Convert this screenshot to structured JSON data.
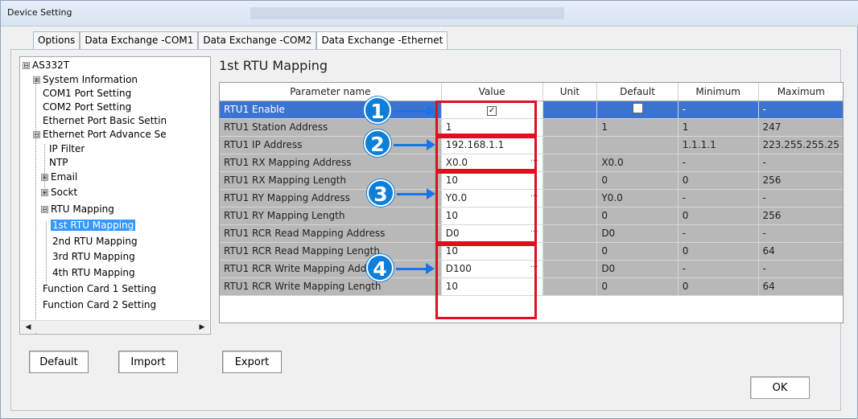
{
  "window": {
    "title": "Device Setting"
  },
  "tabs": [
    {
      "label": "Options"
    },
    {
      "label": "Data Exchange -COM1"
    },
    {
      "label": "Data Exchange -COM2"
    },
    {
      "label": "Data Exchange -Ethernet"
    }
  ],
  "tree": {
    "items": [
      {
        "label": "AS332T"
      },
      {
        "label": "System Information"
      },
      {
        "label": "COM1 Port Setting"
      },
      {
        "label": "COM2 Port Setting"
      },
      {
        "label": "Ethernet Port Basic Settin"
      },
      {
        "label": "Ethernet Port Advance Se"
      },
      {
        "label": "IP Filter"
      },
      {
        "label": "NTP"
      },
      {
        "label": "Email"
      },
      {
        "label": "Sockt"
      },
      {
        "label": "RTU Mapping"
      },
      {
        "label": "1st RTU Mapping"
      },
      {
        "label": "2nd RTU Mapping"
      },
      {
        "label": "3rd RTU Mapping"
      },
      {
        "label": "4th RTU Mapping"
      },
      {
        "label": "Function Card 1 Setting"
      },
      {
        "label": "Function Card 2 Setting"
      }
    ],
    "expanders": {
      "minus": "⊟",
      "plus": "⊞"
    }
  },
  "main": {
    "title": "1st RTU Mapping",
    "columns": [
      "Parameter name",
      "Value",
      "Unit",
      "Default",
      "Minimum",
      "Maximum"
    ],
    "rows": [
      {
        "name": "RTU1 Enable",
        "value": "",
        "unit": "",
        "default": "",
        "min": "-",
        "max": "-"
      },
      {
        "name": "RTU1 Station Address",
        "value": "1",
        "unit": "",
        "default": "1",
        "min": "1",
        "max": "247"
      },
      {
        "name": "RTU1 IP Address",
        "value": "192.168.1.1",
        "unit": "",
        "default": "",
        "min": "1.1.1.1",
        "max": "223.255.255.25"
      },
      {
        "name": "RTU1 RX Mapping Address",
        "value": "X0.0",
        "unit": "",
        "default": "X0.0",
        "min": "-",
        "max": "-"
      },
      {
        "name": "RTU1 RX Mapping Length",
        "value": "10",
        "unit": "",
        "default": "0",
        "min": "0",
        "max": "256"
      },
      {
        "name": "RTU1 RY Mapping Address",
        "value": "Y0.0",
        "unit": "",
        "default": "Y0.0",
        "min": "-",
        "max": "-"
      },
      {
        "name": "RTU1 RY Mapping Length",
        "value": "10",
        "unit": "",
        "default": "0",
        "min": "0",
        "max": "256"
      },
      {
        "name": "RTU1 RCR Read Mapping Address",
        "value": "D0",
        "unit": "",
        "default": "D0",
        "min": "-",
        "max": "-"
      },
      {
        "name": "RTU1 RCR Read Mapping Length",
        "value": "10",
        "unit": "",
        "default": "0",
        "min": "0",
        "max": "64"
      },
      {
        "name": "RTU1 RCR Write Mapping Address",
        "value": "D100",
        "unit": "",
        "default": "D0",
        "min": "-",
        "max": "-"
      },
      {
        "name": "RTU1 RCR Write Mapping Length",
        "value": "10",
        "unit": "",
        "default": "0",
        "min": "0",
        "max": "64"
      }
    ],
    "ellipsis": "···",
    "check_mark": "✓",
    "markers": [
      "1",
      "2",
      "3",
      "4"
    ]
  },
  "buttons": {
    "default": "Default",
    "import": "Import",
    "export": "Export",
    "ok": "OK"
  },
  "colors": {
    "selected_row": "#3b73d1",
    "disabled_cell": "#b8b8b8",
    "highlight_box": "#e20d1e",
    "marker": "#0d7fd8"
  }
}
